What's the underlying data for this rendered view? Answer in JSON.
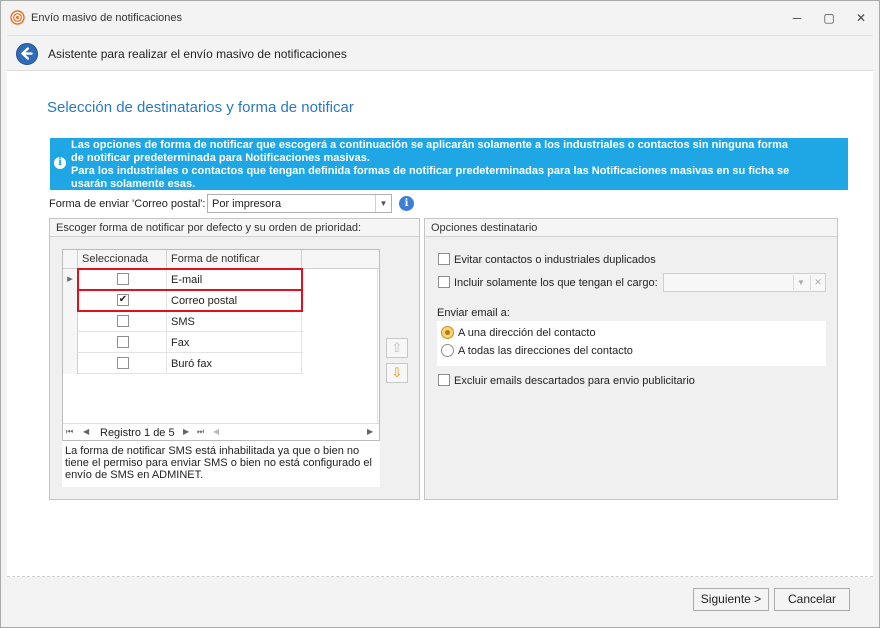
{
  "window": {
    "title": "Envío masivo de notificaciones",
    "minimize_glyph": "─",
    "maximize_glyph": "▢",
    "close_glyph": "✕"
  },
  "wizard": {
    "title": "Asistente para realizar el envío masivo de notificaciones",
    "back_glyph": "←"
  },
  "section": {
    "title": "Selección de destinatarios y forma de notificar"
  },
  "info_banner": {
    "icon_glyph": "i",
    "lines": [
      "Las opciones de forma de notificar que escogerá a continuación se aplicarán solamente a los industriales o contactos sin ninguna forma",
      "de notificar predeterminada para Notificaciones masivas.",
      "Para los  industriales o contactos que tengan definida formas de notificar predeterminadas para las Notificaciones masivas en su ficha se",
      "usarán solamente esas."
    ]
  },
  "forma_enviar": {
    "label": "Forma de enviar 'Correo postal':",
    "value": "Por impresora",
    "arrow": "▼",
    "info_glyph": "i"
  },
  "left_group": {
    "title": "Escoger forma de notificar por defecto y su orden de prioridad:",
    "columns": [
      "Seleccionada",
      "Forma de notificar"
    ],
    "rows": [
      {
        "form": "E-mail",
        "checked": false,
        "current": true
      },
      {
        "form": "Correo postal",
        "checked": true,
        "current": false
      },
      {
        "form": "SMS",
        "checked": false,
        "current": false
      },
      {
        "form": "Fax",
        "checked": false,
        "current": false
      },
      {
        "form": "Buró fax",
        "checked": false,
        "current": false
      }
    ],
    "current_indicator": "▶",
    "check_glyph": "✔",
    "navigator": {
      "first": "⏮",
      "prev": "◀",
      "text": "Registro 1 de 5",
      "next": "▶",
      "last": "⏭",
      "scroll_left": "◀",
      "scroll_right": "▶"
    },
    "note": "La forma de notificar SMS está inhabilitada ya que o bien no tiene el permiso para enviar SMS o bien no está configurado el envío de SMS en ADMINET.",
    "move_up_glyph": "⇧",
    "move_down_glyph": "⇩"
  },
  "right_group": {
    "title": "Opciones destinatario",
    "avoid_duplicates": {
      "label": "Evitar contactos o industriales duplicados",
      "checked": false
    },
    "only_cargo": {
      "label": "Incluir solamente los que tengan el cargo:",
      "checked": false,
      "combo_value": ""
    },
    "combo_arrow": "▼",
    "combo_clear": "✕",
    "send_email_label": "Enviar email a:",
    "radios": [
      {
        "label": "A una dirección del contacto",
        "selected": true
      },
      {
        "label": "A todas las direcciones del contacto",
        "selected": false
      }
    ],
    "exclude_discarded": {
      "label": "Excluir emails descartados para envio publicitario",
      "checked": false
    }
  },
  "footer": {
    "next_label": "Siguiente >",
    "cancel_label": "Cancelar"
  },
  "colors": {
    "banner": "#1ea7e4",
    "section_title": "#2b78c2",
    "highlight": "#e0101e",
    "down_arrow": "#e8910c"
  }
}
